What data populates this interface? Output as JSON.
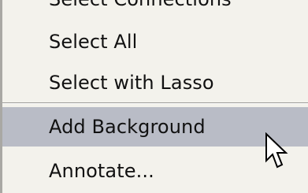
{
  "context_menu": {
    "items": [
      {
        "label": "Select Connections",
        "highlighted": false
      },
      {
        "label": "Select All",
        "highlighted": false
      },
      {
        "label": "Select with Lasso",
        "highlighted": false
      },
      {
        "label": "Add Background",
        "highlighted": true
      },
      {
        "label": "Annotate...",
        "highlighted": false
      }
    ],
    "highlight_color": "#b9bcc6",
    "background_color": "#f3f2ec"
  },
  "cursor": {
    "icon": "arrow-pointer-icon"
  }
}
